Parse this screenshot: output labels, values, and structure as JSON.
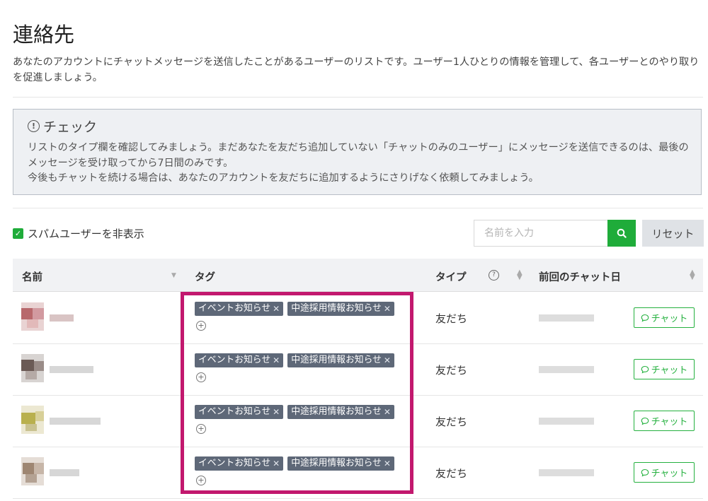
{
  "page": {
    "title": "連絡先",
    "description": "あなたのアカウントにチャットメッセージを送信したことがあるユーザーのリストです。ユーザー1人ひとりの情報を管理して、各ユーザーとのやり取りを促進しましょう。"
  },
  "notice": {
    "icon": "info-circle-icon",
    "title": "チェック",
    "lines": [
      "リストのタイプ欄を確認してみましょう。まだあなたを友だち追加していない「チャットのみのユーザー」にメッセージを送信できるのは、最後のメッセージを受け取ってから7日間のみです。",
      "今後もチャットを続ける場合は、あなたのアカウントを友だちに追加するようにさりげなく依頼してみましょう。"
    ]
  },
  "filter": {
    "hide_spam_label": "スパムユーザーを非表示",
    "hide_spam_checked": true
  },
  "search": {
    "placeholder": "名前を入力",
    "value": "",
    "reset_label": "リセット"
  },
  "table": {
    "columns": [
      "名前",
      "タグ",
      "タイプ",
      "前回のチャット日"
    ],
    "rows": [
      {
        "tags": [
          "イベントお知らせ",
          "中途採用情報お知らせ"
        ],
        "type": "友だち",
        "chat_label": "チャット"
      },
      {
        "tags": [
          "イベントお知らせ",
          "中途採用情報お知らせ"
        ],
        "type": "友だち",
        "chat_label": "チャット"
      },
      {
        "tags": [
          "イベントお知らせ",
          "中途採用情報お知らせ"
        ],
        "type": "友だち",
        "chat_label": "チャット"
      },
      {
        "tags": [
          "イベントお知らせ",
          "中途採用情報お知らせ"
        ],
        "type": "友だち",
        "chat_label": "チャット"
      }
    ]
  },
  "colors": {
    "accent_green": "#1fac3a",
    "tag_bg": "#5e6878",
    "highlight": "#c2186e"
  }
}
